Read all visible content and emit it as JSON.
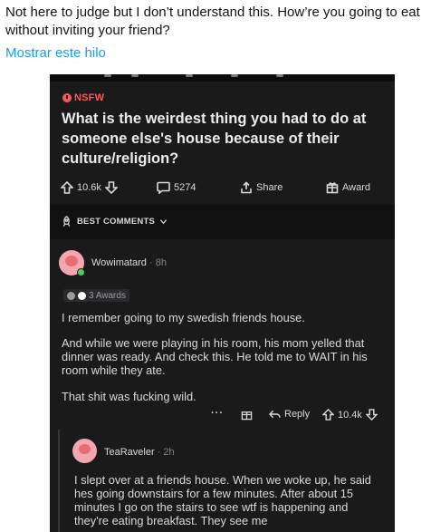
{
  "tweet": {
    "text": "Not here to judge but I don’t understand this. How’re you going to eat without inviting your friend?",
    "show_thread": "Mostrar este hilo"
  },
  "post": {
    "nsfw_label": "NSFW",
    "title": "What is the weirdest thing you had to do at someone else's house because of their culture/religion?",
    "upvotes": "10.6k",
    "comments": "5274",
    "share_label": "Share",
    "award_label": "Award",
    "sort_label": "BEST COMMENTS"
  },
  "comment1": {
    "author": "Wowimatard",
    "time": "· 8h",
    "awards": "3 Awards",
    "paragraphs": [
      "I remember going to my swedish friends house.",
      "And while we were playing in his room, his mom yelled that dinner was ready. And check this. He told me to WAIT in his room while they ate.",
      "That shit was fucking wild."
    ],
    "more": "···",
    "reply_label": "Reply",
    "votes": "10.4k"
  },
  "comment2": {
    "author": "TeaRaveler",
    "time": "· 2h",
    "text": "I slept over at a friends house. When we woke up, he said hes going downstairs for a few minutes. After about 15 minutes I go on the stairs to see wtf is happening and they're eating breakfast. They see me"
  },
  "colors": {
    "reddit_dark_bg": "#1a1a1b",
    "nsfw_red": "#ff585b",
    "link_blue": "#1d9bf0",
    "avatar_pink": "#f4a7b0",
    "online_green": "#46d160"
  }
}
